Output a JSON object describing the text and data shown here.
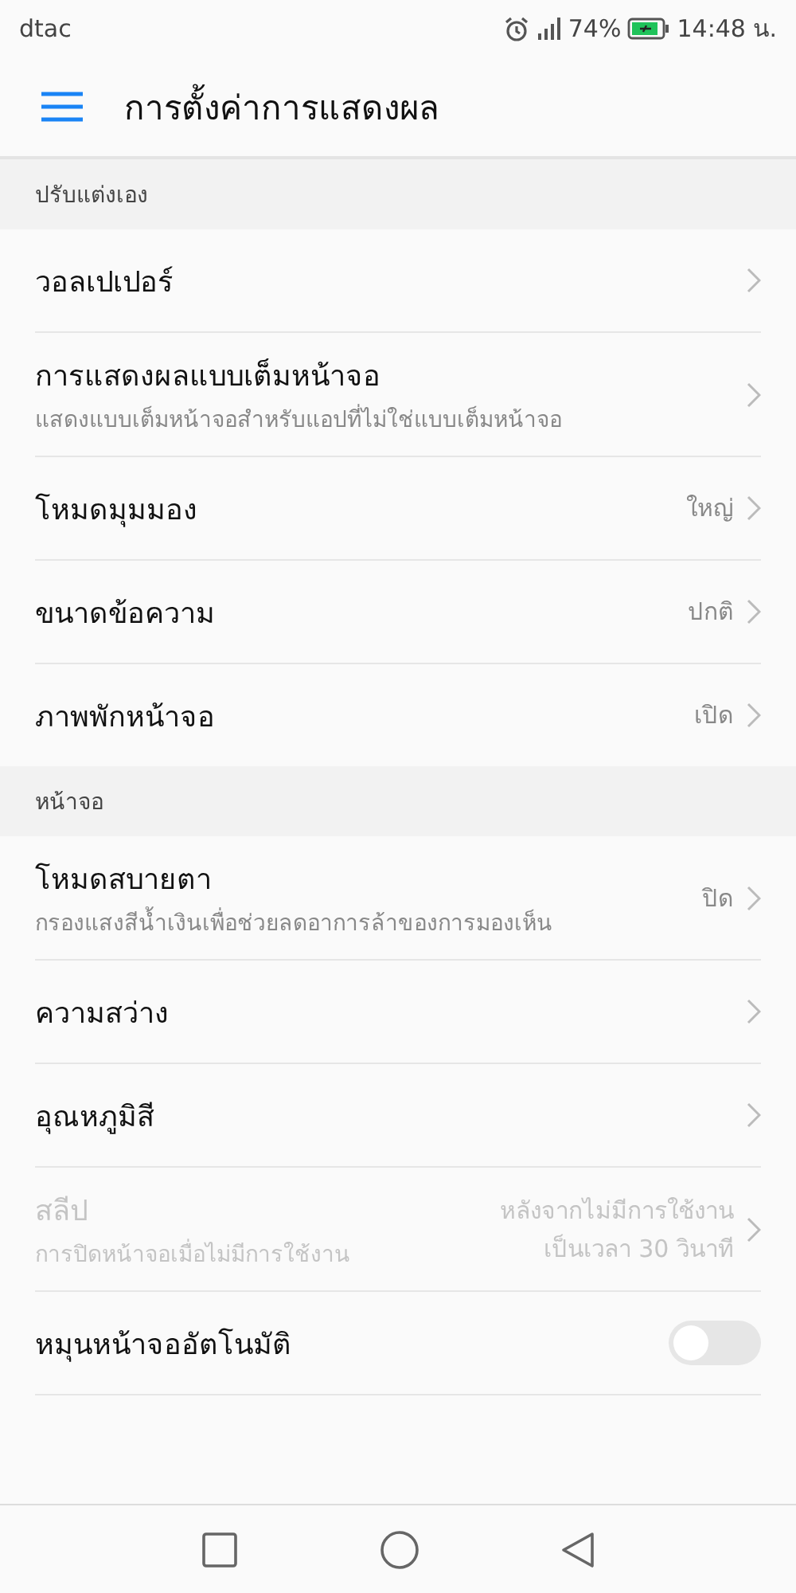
{
  "status_bar": {
    "carrier": "dtac",
    "battery_percent": "74%",
    "time": "14:48 น."
  },
  "app_bar": {
    "title": "การตั้งค่าการแสดงผล"
  },
  "sections": [
    {
      "title": "ปรับแต่งเอง",
      "rows": [
        {
          "kind": "link",
          "label": "วอลเปเปอร์",
          "disabled": false
        },
        {
          "kind": "link",
          "label": "การแสดงผลแบบเต็มหน้าจอ",
          "description": "แสดงแบบเต็มหน้าจอสำหรับแอปที่ไม่ใช่แบบเต็มหน้าจอ",
          "disabled": false
        },
        {
          "kind": "link",
          "label": "โหมดมุมมอง",
          "value": "ใหญ่",
          "disabled": false
        },
        {
          "kind": "link",
          "label": "ขนาดข้อความ",
          "value": "ปกติ",
          "disabled": false
        },
        {
          "kind": "link",
          "label": "ภาพพักหน้าจอ",
          "value": "เปิด",
          "disabled": false
        }
      ]
    },
    {
      "title": "หน้าจอ",
      "rows": [
        {
          "kind": "link",
          "label": "โหมดสบายตา",
          "description": "กรองแสงสีน้ำเงินเพื่อช่วยลดอาการล้าของการมองเห็น",
          "value": "ปิด",
          "disabled": false
        },
        {
          "kind": "link",
          "label": "ความสว่าง",
          "disabled": false
        },
        {
          "kind": "link",
          "label": "อุณหภูมิสี",
          "disabled": false
        },
        {
          "kind": "link",
          "label": "สลีป",
          "description": "การปิดหน้าจอเมื่อไม่มีการใช้งาน",
          "value": "หลังจากไม่มีการใช้งานเป็นเวลา 30 วินาที",
          "disabled": true
        },
        {
          "kind": "toggle",
          "label": "หมุนหน้าจออัตโนมัติ",
          "on": false,
          "disabled": false
        }
      ]
    }
  ]
}
